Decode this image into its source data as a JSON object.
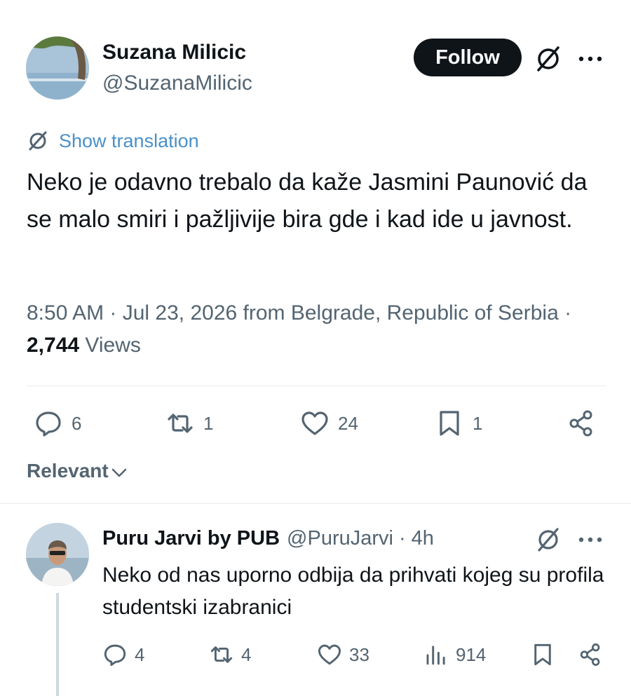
{
  "tweet": {
    "author_name": "Suzana Milicic",
    "author_handle": "@SuzanaMilicic",
    "follow_label": "Follow",
    "translation_label": "Show translation",
    "text": "Neko je odavno trebalo da kaže Jasmini Paunović da se malo smiri i pažljivije bira gde i kad ide u javnost.",
    "meta_prefix": "8:50 AM · Jul 23, 2026 from Belgrade, Republic of Serbia · ",
    "views_count": "2,744",
    "views_label": " Views",
    "actions": {
      "replies": "6",
      "reposts": "1",
      "likes": "24",
      "bookmarks": "1"
    }
  },
  "sort": {
    "label": "Relevant"
  },
  "reply": {
    "author_name": "Puru Jarvi by PUB",
    "author_handle": "@PuruJarvi",
    "separator": "·",
    "time": "4h",
    "text": "Neko od nas uporno odbija da prihvati kojeg su profila studentski izabranici",
    "actions": {
      "replies": "4",
      "reposts": "4",
      "likes": "33",
      "views": "914"
    }
  },
  "colors": {
    "text_primary": "#0f1419",
    "text_secondary": "#536471",
    "link": "#4a90c8",
    "follow_bg": "#0f1419"
  }
}
